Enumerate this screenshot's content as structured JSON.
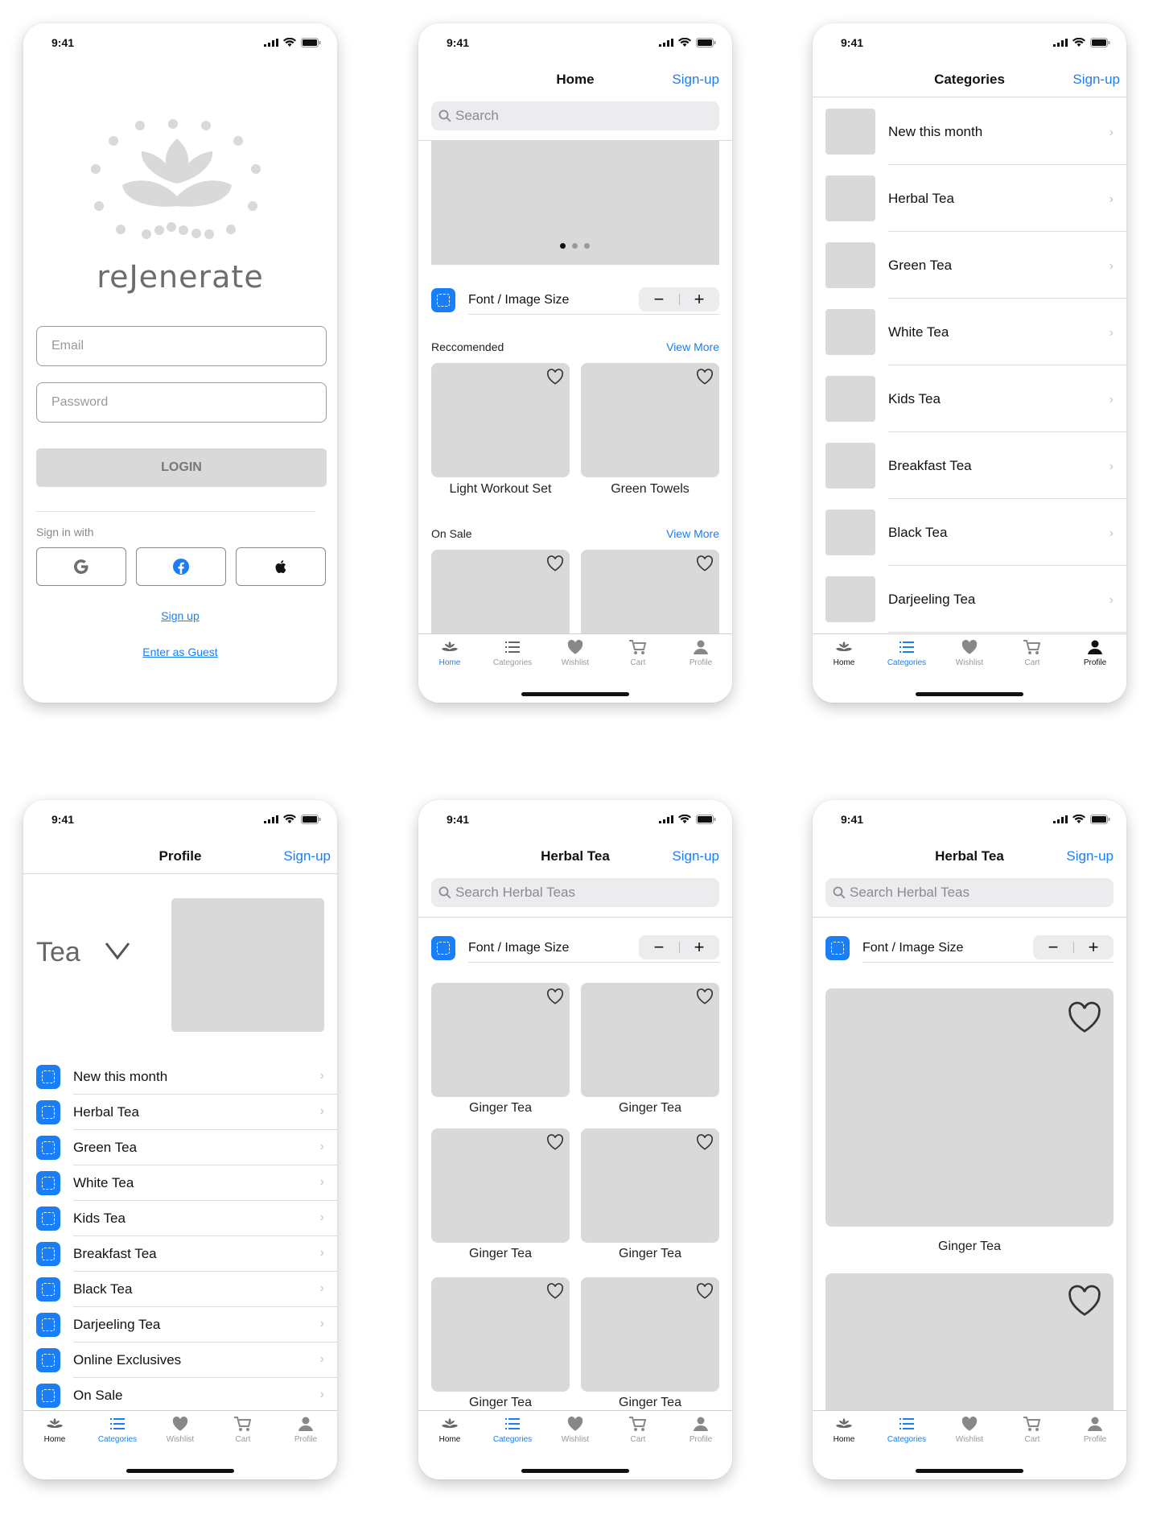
{
  "status": {
    "time": "9:41"
  },
  "login": {
    "brand": "reJenerate",
    "email_placeholder": "Email",
    "password_placeholder": "Password",
    "login_label": "LOGIN",
    "sign_in_with": "Sign in with",
    "signup_link": "Sign up",
    "guest_link": "Enter as Guest"
  },
  "home": {
    "title": "Home",
    "signup": "Sign-up",
    "search_placeholder": "Search",
    "font_size_label": "Font / Image Size",
    "minus": "−",
    "plus": "+",
    "recommended": {
      "title": "Reccomended",
      "view_more": "View More",
      "items": [
        "Light Workout Set",
        "Green Towels"
      ]
    },
    "on_sale": {
      "title": "On Sale",
      "view_more": "View More"
    }
  },
  "categories": {
    "title": "Categories",
    "signup": "Sign-up",
    "items": [
      "New this month",
      "Herbal Tea",
      "Green Tea",
      "White Tea",
      "Kids Tea",
      "Breakfast Tea",
      "Black Tea",
      "Darjeeling Tea"
    ]
  },
  "profile": {
    "title": "Profile",
    "signup": "Sign-up",
    "selector_label": "Tea",
    "selector_icon": "chevron-down-icon",
    "items": [
      "New this month",
      "Herbal Tea",
      "Green Tea",
      "White Tea",
      "Kids Tea",
      "Breakfast Tea",
      "Black Tea",
      "Darjeeling Tea",
      "Online Exclusives",
      "On Sale"
    ]
  },
  "herbal_grid": {
    "title": "Herbal Tea",
    "signup": "Sign-up",
    "search_placeholder": "Search Herbal Teas",
    "font_size_label": "Font / Image Size",
    "minus": "−",
    "plus": "+",
    "products": [
      "Ginger Tea",
      "Ginger Tea",
      "Ginger Tea",
      "Ginger Tea",
      "Ginger Tea",
      "Ginger Tea"
    ]
  },
  "herbal_large": {
    "title": "Herbal Tea",
    "signup": "Sign-up",
    "search_placeholder": "Search Herbal Teas",
    "font_size_label": "Font / Image Size",
    "minus": "−",
    "plus": "+",
    "products": [
      "Ginger Tea"
    ]
  },
  "tabs": [
    "Home",
    "Categories",
    "Wishlist",
    "Cart",
    "Profile"
  ],
  "colors": {
    "accent": "#1a7ef7",
    "placeholder_gray": "#d9d9d9"
  }
}
